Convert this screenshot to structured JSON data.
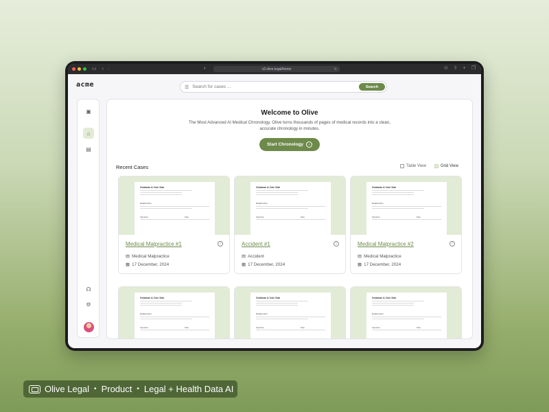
{
  "browser": {
    "url": "v2.olive.legal/home"
  },
  "app": {
    "logo": "acme",
    "search": {
      "placeholder": "Search for cases ...",
      "button_label": "Search"
    }
  },
  "sidebar": {
    "items": [
      {
        "name": "dashboard",
        "icon": "dashboard-icon"
      },
      {
        "name": "home",
        "icon": "home-icon",
        "active": true
      },
      {
        "name": "documents",
        "icon": "documents-icon"
      },
      {
        "name": "support",
        "icon": "headset-icon"
      },
      {
        "name": "settings",
        "icon": "gear-icon"
      }
    ]
  },
  "welcome": {
    "title": "Welcome to Olive",
    "subtitle": "The Most Advanced AI Medical Chronology. Olive turns thousands of pages of medical records into a clean, accurate chronology in minutes.",
    "cta_label": "Start Chronology"
  },
  "recent": {
    "title": "Recent Cases",
    "table_view_label": "Table View",
    "grid_view_label": "Grid View"
  },
  "doc_preview": {
    "title": "Goldman & Cole Stat",
    "section_label": "Relationship",
    "sign_left": "Signature",
    "sign_right": "Date"
  },
  "cases": [
    {
      "name": "Medical Malpractice #1",
      "type": "Medical Malpractice",
      "date": "17 December, 2024"
    },
    {
      "name": "Accident #1",
      "type": "Accident",
      "date": "17 December, 2024"
    },
    {
      "name": "Medical Malpractice #2",
      "type": "Medical Malpractice",
      "date": "17 December, 2024"
    },
    {
      "name": "",
      "type": "",
      "date": ""
    },
    {
      "name": "",
      "type": "",
      "date": ""
    },
    {
      "name": "",
      "type": "",
      "date": ""
    }
  ],
  "caption": {
    "brand": "Olive Legal",
    "tag1": "Product",
    "tag2": "Legal + Health Data AI"
  },
  "colors": {
    "accent": "#6d8a4a",
    "accent_light": "#e2ebd5",
    "caption_bg": "#4f6636"
  }
}
